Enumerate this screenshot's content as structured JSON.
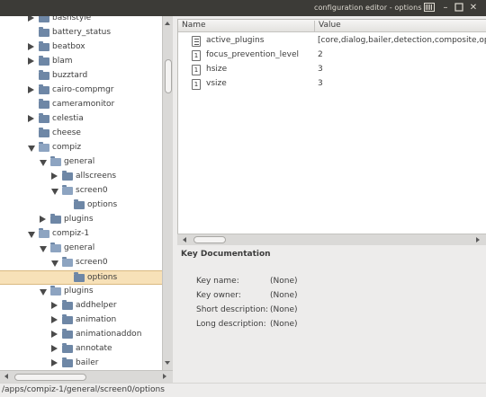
{
  "window": {
    "title": "configuration editor - options"
  },
  "tree": {
    "items": [
      {
        "label": "bashstyle",
        "depth": 0,
        "expander": "closed",
        "open": false
      },
      {
        "label": "battery_status",
        "depth": 0,
        "expander": "none",
        "open": false
      },
      {
        "label": "beatbox",
        "depth": 0,
        "expander": "closed",
        "open": false
      },
      {
        "label": "blam",
        "depth": 0,
        "expander": "closed",
        "open": false
      },
      {
        "label": "buzztard",
        "depth": 0,
        "expander": "none",
        "open": false
      },
      {
        "label": "cairo-compmgr",
        "depth": 0,
        "expander": "closed",
        "open": false
      },
      {
        "label": "cameramonitor",
        "depth": 0,
        "expander": "none",
        "open": false
      },
      {
        "label": "celestia",
        "depth": 0,
        "expander": "closed",
        "open": false
      },
      {
        "label": "cheese",
        "depth": 0,
        "expander": "none",
        "open": false
      },
      {
        "label": "compiz",
        "depth": 0,
        "expander": "open",
        "open": true
      },
      {
        "label": "general",
        "depth": 1,
        "expander": "open",
        "open": true
      },
      {
        "label": "allscreens",
        "depth": 2,
        "expander": "closed",
        "open": false
      },
      {
        "label": "screen0",
        "depth": 2,
        "expander": "open",
        "open": true
      },
      {
        "label": "options",
        "depth": 3,
        "expander": "none",
        "open": false
      },
      {
        "label": "plugins",
        "depth": 1,
        "expander": "closed",
        "open": false
      },
      {
        "label": "compiz-1",
        "depth": 0,
        "expander": "open",
        "open": true
      },
      {
        "label": "general",
        "depth": 1,
        "expander": "open",
        "open": true
      },
      {
        "label": "screen0",
        "depth": 2,
        "expander": "open",
        "open": true
      },
      {
        "label": "options",
        "depth": 3,
        "expander": "none",
        "open": false,
        "selected": true
      },
      {
        "label": "plugins",
        "depth": 1,
        "expander": "open",
        "open": true
      },
      {
        "label": "addhelper",
        "depth": 2,
        "expander": "closed",
        "open": false
      },
      {
        "label": "animation",
        "depth": 2,
        "expander": "closed",
        "open": false
      },
      {
        "label": "animationaddon",
        "depth": 2,
        "expander": "closed",
        "open": false
      },
      {
        "label": "annotate",
        "depth": 2,
        "expander": "closed",
        "open": false
      },
      {
        "label": "bailer",
        "depth": 2,
        "expander": "closed",
        "open": false
      }
    ]
  },
  "keylist": {
    "header": {
      "name": "Name",
      "value": "Value"
    },
    "rows": [
      {
        "name": "active_plugins",
        "value": "[core,dialog,bailer,detection,composite,ope",
        "icon": "list-icon"
      },
      {
        "name": "focus_prevention_level",
        "value": "2",
        "icon": "integer-icon"
      },
      {
        "name": "hsize",
        "value": "3",
        "icon": "integer-icon"
      },
      {
        "name": "vsize",
        "value": "3",
        "icon": "integer-icon"
      }
    ]
  },
  "doc": {
    "title": "Key Documentation",
    "rows": [
      {
        "label": "Key name:",
        "value": "(None)"
      },
      {
        "label": "Key owner:",
        "value": "(None)"
      },
      {
        "label": "Short description:",
        "value": "(None)"
      },
      {
        "label": "Long description:",
        "value": "(None)"
      }
    ]
  },
  "status": {
    "path": "/apps/compiz-1/general/screen0/options"
  },
  "colors": {
    "titlebar": "#3c3b37",
    "selection": "#f7e1b8",
    "folder": "#6e87a6"
  }
}
